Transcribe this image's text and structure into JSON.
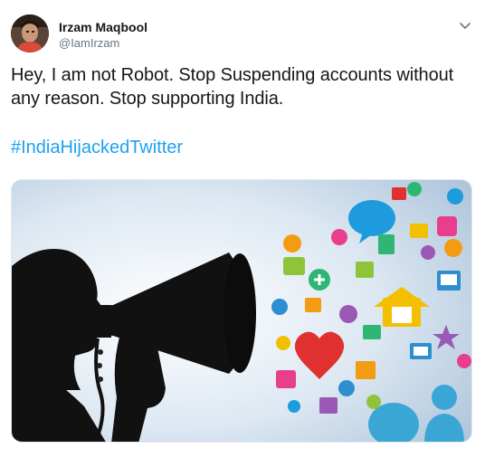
{
  "author": {
    "name": "Irzam Maqbool",
    "handle": "@IamIrzam"
  },
  "tweet": {
    "text": "Hey, I am not Robot. Stop Suspending accounts without any reason. Stop supporting India.",
    "hashtag": "#IndiaHijackedTwitter"
  },
  "icons": {
    "more": "chevron-down-icon",
    "avatar": "avatar-photo"
  },
  "colors": {
    "link": "#1da1f2",
    "text": "#14171a",
    "secondary": "#657786"
  }
}
